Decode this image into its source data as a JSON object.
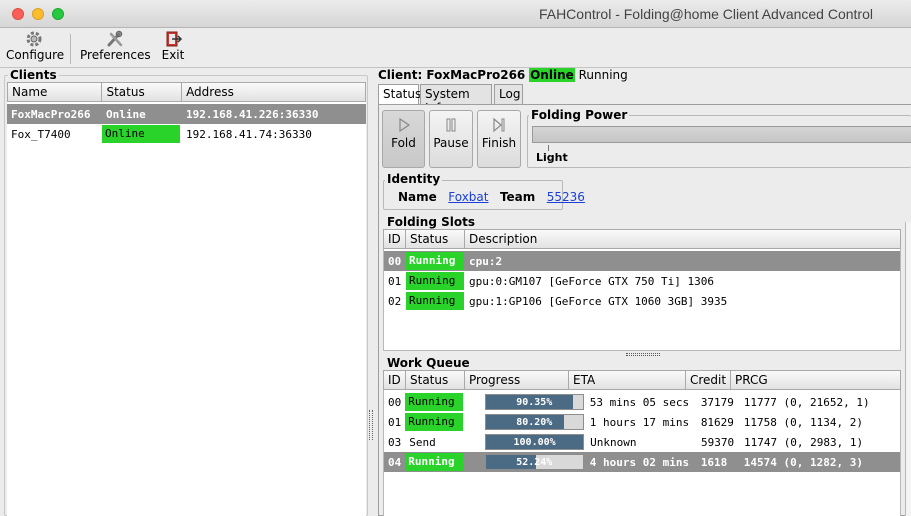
{
  "window": {
    "title": "FAHControl - Folding@home Client Advanced Control",
    "colors": {
      "close": "#fc5f57",
      "minimize": "#fdbc2e",
      "zoom": "#28c840"
    }
  },
  "toolbar": {
    "configure_label": "Configure",
    "preferences_label": "Preferences",
    "exit_label": "Exit"
  },
  "clients": {
    "label": "Clients",
    "columns": [
      "Name",
      "Status",
      "Address"
    ],
    "rows": [
      {
        "name": "FoxMacPro266",
        "status": "Online",
        "address": "192.168.41.226:36330",
        "selected": true
      },
      {
        "name": "Fox_T7400",
        "status": "Online",
        "address": "192.168.41.74:36330",
        "selected": false
      }
    ]
  },
  "client_header": {
    "prefix": "Client: FoxMacPro266",
    "status": "Online",
    "state": "Running"
  },
  "tabs": [
    "Status",
    "System Info",
    "Log"
  ],
  "actions": {
    "fold_label": "Fold",
    "pause_label": "Pause",
    "finish_label": "Finish"
  },
  "folding_power": {
    "label": "Folding Power",
    "level_label": "Light"
  },
  "identity": {
    "label": "Identity",
    "name_label": "Name",
    "name_value": "Foxbat",
    "team_label": "Team",
    "team_value": "55236"
  },
  "folding_slots": {
    "label": "Folding Slots",
    "columns": [
      "ID",
      "Status",
      "Description"
    ],
    "rows": [
      {
        "id": "00",
        "status": "Running",
        "description": "cpu:2",
        "selected": true
      },
      {
        "id": "01",
        "status": "Running",
        "description": "gpu:0:GM107 [GeForce GTX 750 Ti] 1306",
        "selected": false
      },
      {
        "id": "02",
        "status": "Running",
        "description": "gpu:1:GP106 [GeForce GTX 1060 3GB] 3935",
        "selected": false
      }
    ]
  },
  "work_queue": {
    "label": "Work Queue",
    "columns": [
      "ID",
      "Status",
      "Progress",
      "ETA",
      "Credit",
      "PRCG"
    ],
    "rows": [
      {
        "id": "00",
        "status": "Running",
        "progress_text": "90.35%",
        "progress": 90.35,
        "eta": "53 mins 05 secs",
        "credit": "37179",
        "prcg": "11777 (0, 21652, 1)",
        "status_green": true,
        "selected": false
      },
      {
        "id": "01",
        "status": "Running",
        "progress_text": "80.20%",
        "progress": 80.2,
        "eta": "1 hours 17 mins",
        "credit": "81629",
        "prcg": "11758 (0, 1134, 2)",
        "status_green": true,
        "selected": false
      },
      {
        "id": "03",
        "status": "Send",
        "progress_text": "100.00%",
        "progress": 100.0,
        "eta": "Unknown",
        "credit": "59370",
        "prcg": "11747 (0, 2983, 1)",
        "status_green": false,
        "selected": false
      },
      {
        "id": "04",
        "status": "Running",
        "progress_text": "52.24%",
        "progress": 52.24,
        "eta": "4 hours 02 mins",
        "credit": "1618",
        "prcg": "14574 (0, 1282, 3)",
        "status_green": true,
        "selected": true
      }
    ]
  }
}
